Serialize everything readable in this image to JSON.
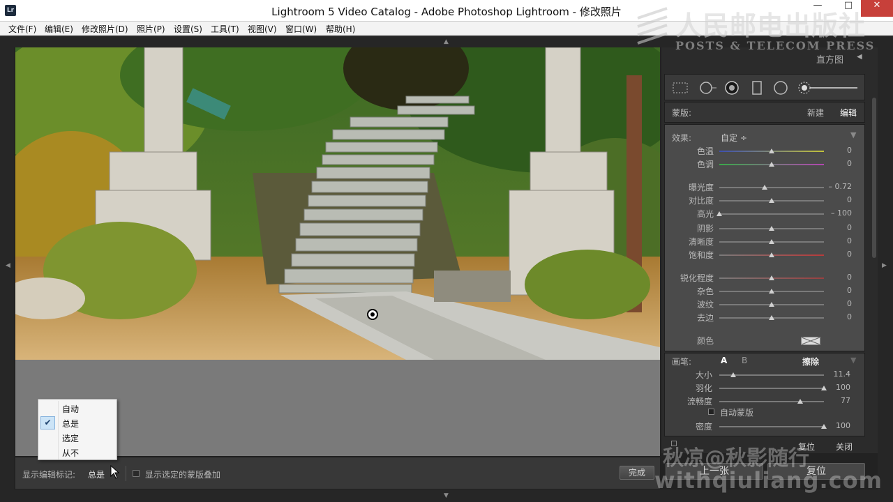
{
  "window": {
    "title": "Lightroom 5 Video Catalog - Adobe Photoshop Lightroom - 修改照片",
    "logo": "Lr",
    "minimize": "—",
    "maximize": "□",
    "close": "✕"
  },
  "menubar": [
    "文件(F)",
    "编辑(E)",
    "修改照片(D)",
    "照片(P)",
    "设置(S)",
    "工具(T)",
    "视图(V)",
    "窗口(W)",
    "帮助(H)"
  ],
  "histogram": {
    "title": "直方图",
    "arrow": "◀"
  },
  "mask": {
    "label": "蒙版:",
    "new": "新建",
    "edit": "编辑"
  },
  "effect": {
    "label": "效果:",
    "value": "自定 ÷",
    "collapse": "▼"
  },
  "adjustments": [
    {
      "label": "色温",
      "value": "0",
      "pos": 0.5,
      "colors": [
        "#3d4fb0",
        "#c2c23a"
      ]
    },
    {
      "label": "色调",
      "value": "0",
      "pos": 0.5,
      "colors": [
        "#3aa84a",
        "#b246b0"
      ]
    },
    {
      "label": "曝光度",
      "value": "– 0.72",
      "pos": 0.43,
      "colors": null
    },
    {
      "label": "对比度",
      "value": "0",
      "pos": 0.5,
      "colors": null
    },
    {
      "label": "高光",
      "value": "– 100",
      "pos": 0.0,
      "colors": null
    },
    {
      "label": "阴影",
      "value": "0",
      "pos": 0.5,
      "colors": null
    },
    {
      "label": "清晰度",
      "value": "0",
      "pos": 0.5,
      "colors": null
    },
    {
      "label": "饱和度",
      "value": "0",
      "pos": 0.5,
      "colors": [
        "#7a7a7a",
        "#b83a3a"
      ]
    },
    {
      "label": "锐化程度",
      "value": "0",
      "pos": 0.5,
      "colors": [
        "#7a7a7a",
        "#9a4040"
      ]
    },
    {
      "label": "杂色",
      "value": "0",
      "pos": 0.5,
      "colors": null
    },
    {
      "label": "波纹",
      "value": "0",
      "pos": 0.5,
      "colors": null
    },
    {
      "label": "去边",
      "value": "0",
      "pos": 0.5,
      "colors": null
    }
  ],
  "color_label": "颜色",
  "brush": {
    "label": "画笔:",
    "a": "A",
    "b": "B",
    "erase": "擦除",
    "collapse": "▼",
    "rows": [
      {
        "label": "大小",
        "value": "11.4",
        "pos": 0.13
      },
      {
        "label": "羽化",
        "value": "100",
        "pos": 1.0
      },
      {
        "label": "流畅度",
        "value": "77",
        "pos": 0.77
      },
      {
        "label": "密度",
        "value": "100",
        "pos": 1.0
      }
    ],
    "auto_mask": "自动蒙版"
  },
  "panel_buttons": {
    "reset": "复位",
    "close": "关闭",
    "prev": "上一张",
    "reset_all": "复位"
  },
  "toolbar": {
    "show_edit_pins_label": "显示编辑标记:",
    "show_edit_pins_value": "总是",
    "show_mask_overlay": "显示选定的蒙版叠加",
    "done": "完成"
  },
  "context_menu": {
    "items": [
      "自动",
      "总是",
      "选定",
      "从不"
    ],
    "checked_index": 1,
    "check_glyph": "✔"
  },
  "watermarks": {
    "publisher": "人民邮电出版社",
    "publisher_en": "POSTS & TELECOM PRESS",
    "author": "秋凉@秋影随行",
    "site": "withqiuliang.com"
  }
}
